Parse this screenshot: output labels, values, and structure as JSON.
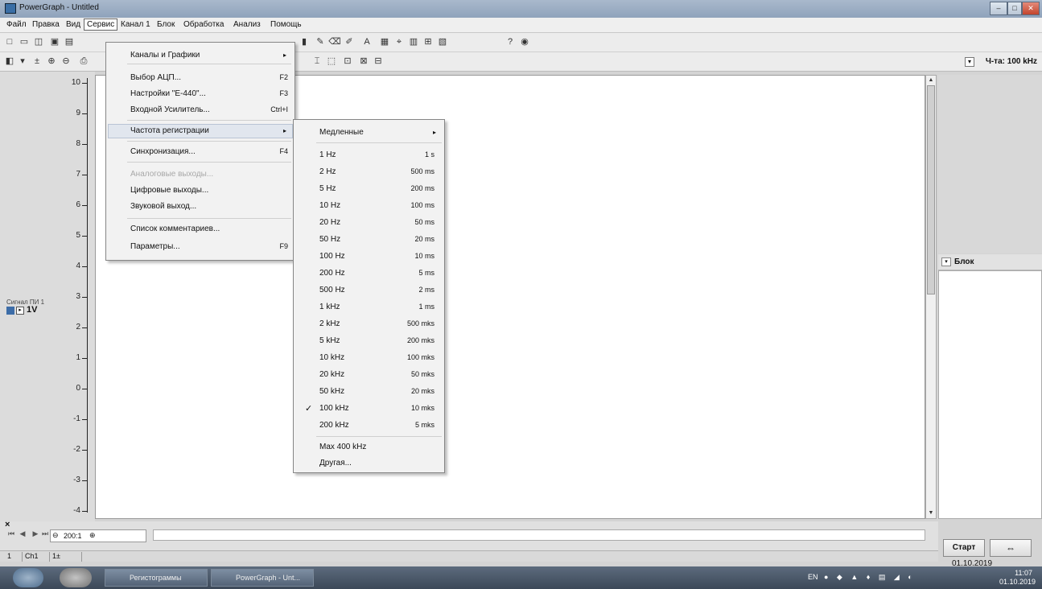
{
  "window": {
    "title": "PowerGraph - Untitled",
    "controls": [
      "–",
      "□",
      "✕"
    ]
  },
  "menubar": {
    "items": [
      "Файл",
      "Правка",
      "Вид",
      "Сервис",
      "Канал 1",
      "Блок",
      "Обработка",
      "Анализ",
      "Помощь"
    ]
  },
  "toolbar": {
    "frequency_label": "Ч-та: 100 kHz"
  },
  "axis": {
    "ticks": [
      "10",
      "9",
      "8",
      "7",
      "6",
      "5",
      "4",
      "3",
      "2",
      "1",
      "0",
      "-1",
      "-2",
      "-3",
      "-4"
    ]
  },
  "channel": {
    "name": "Сигнал ПИ 1",
    "scale": "1V"
  },
  "service_menu": {
    "items": [
      {
        "label": "Каналы и Графики",
        "shortcut": "",
        "submenu": true,
        "disabled": false
      },
      {
        "label": "Выбор АЦП...",
        "shortcut": "F2",
        "submenu": false,
        "disabled": false
      },
      {
        "label": "Настройки \"E-440\"...",
        "shortcut": "F3",
        "submenu": false,
        "disabled": false
      },
      {
        "label": "Входной Усилитель...",
        "shortcut": "Ctrl+I",
        "submenu": false,
        "disabled": false
      },
      {
        "label": "Частота регистрации",
        "shortcut": "",
        "submenu": true,
        "disabled": false
      },
      {
        "label": "Синхронизация...",
        "shortcut": "F4",
        "submenu": false,
        "disabled": false
      },
      {
        "label": "Аналоговые выходы...",
        "shortcut": "",
        "submenu": false,
        "disabled": true
      },
      {
        "label": "Цифровые выходы...",
        "shortcut": "",
        "submenu": false,
        "disabled": false
      },
      {
        "label": "Звуковой выход...",
        "shortcut": "",
        "submenu": false,
        "disabled": false
      },
      {
        "label": "Список комментариев...",
        "shortcut": "",
        "submenu": false,
        "disabled": false
      },
      {
        "label": "Параметры...",
        "shortcut": "F9",
        "submenu": false,
        "disabled": false
      }
    ]
  },
  "frequency_menu": {
    "header": "Медленные",
    "items": [
      {
        "label": "1 Hz",
        "period": "1 s"
      },
      {
        "label": "2 Hz",
        "period": "500 ms"
      },
      {
        "label": "5 Hz",
        "period": "200 ms"
      },
      {
        "label": "10 Hz",
        "period": "100 ms"
      },
      {
        "label": "20 Hz",
        "period": "50 ms"
      },
      {
        "label": "50 Hz",
        "period": "20 ms"
      },
      {
        "label": "100 Hz",
        "period": "10 ms"
      },
      {
        "label": "200 Hz",
        "period": "5 ms"
      },
      {
        "label": "500 Hz",
        "period": "2 ms"
      },
      {
        "label": "1 kHz",
        "period": "1 ms"
      },
      {
        "label": "2 kHz",
        "period": "500 mks"
      },
      {
        "label": "5 kHz",
        "period": "200 mks"
      },
      {
        "label": "10 kHz",
        "period": "100 mks"
      },
      {
        "label": "20 kHz",
        "period": "50 mks"
      },
      {
        "label": "50 kHz",
        "period": "20 mks"
      },
      {
        "label": "100 kHz",
        "period": "10 mks",
        "checked": true
      },
      {
        "label": "200 kHz",
        "period": "5 mks"
      }
    ],
    "max_label": "Max 400 kHz",
    "other_label": "Другая..."
  },
  "right_panel": {
    "block_label": "Блок"
  },
  "buttons": {
    "start": "Старт",
    "connect_icon": "connect-icon"
  },
  "navigation": {
    "zoom_value": "200:1"
  },
  "status": {
    "cells": [
      "1",
      "Ch1",
      "1±"
    ],
    "date": "01.10.2019"
  },
  "taskbar": {
    "buttons": [
      "Регистограммы",
      "PowerGraph - Unt..."
    ],
    "lang": "EN",
    "time": "11:07",
    "date": "01.10.2019"
  }
}
